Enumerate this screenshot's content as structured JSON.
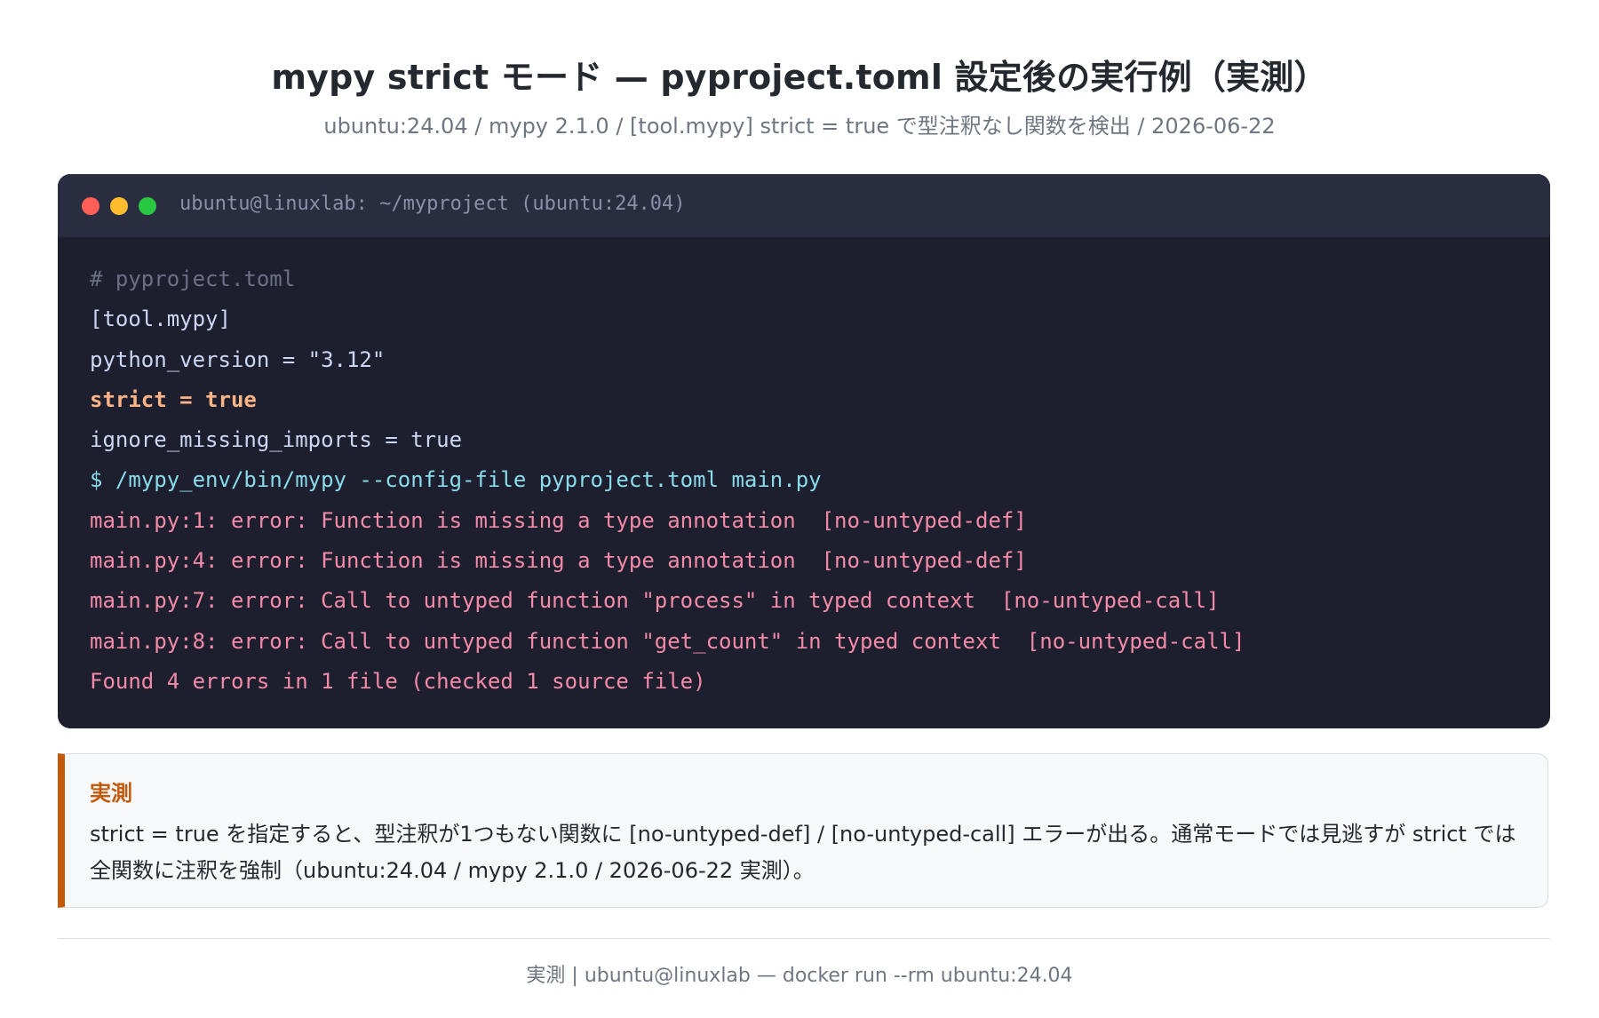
{
  "header": {
    "title": "mypy strict モード — pyproject.toml 設定後の実行例（実測）",
    "subtitle": "ubuntu:24.04 / mypy 2.1.0 / [tool.mypy] strict = true で型注釈なし関数を検出 / 2026-06-22"
  },
  "terminal": {
    "window_title": "ubuntu@linuxlab: ~/myproject (ubuntu:24.04)",
    "lines": [
      "# pyproject.toml",
      "[tool.mypy]",
      "python_version = \"3.12\"",
      "strict = true",
      "ignore_missing_imports = true",
      "$ /mypy_env/bin/mypy --config-file pyproject.toml main.py",
      "main.py:1: error: Function is missing a type annotation  [no-untyped-def]",
      "main.py:4: error: Function is missing a type annotation  [no-untyped-def]",
      "main.py:7: error: Call to untyped function \"process\" in typed context  [no-untyped-call]",
      "main.py:8: error: Call to untyped function \"get_count\" in typed context  [no-untyped-call]",
      "Found 4 errors in 1 file (checked 1 source file)"
    ],
    "colors": {
      "background": "#1e1f2e",
      "comment": "#6c7086",
      "plain": "#cdd6f4",
      "highlight": "#fab387",
      "command": "#89dceb",
      "error": "#f38ba8"
    }
  },
  "note": {
    "label": "実測",
    "text": "strict = true を指定すると、型注釈が1つもない関数に [no-untyped-def] / [no-untyped-call] エラーが出る。通常モードでは見逃すが strict では全関数に注釈を強制（ubuntu:24.04 / mypy 2.1.0 / 2026-06-22 実測）。",
    "accent_color": "#c4590a"
  },
  "footer": {
    "text": "実測 | ubuntu@linuxlab — docker run --rm ubuntu:24.04"
  }
}
